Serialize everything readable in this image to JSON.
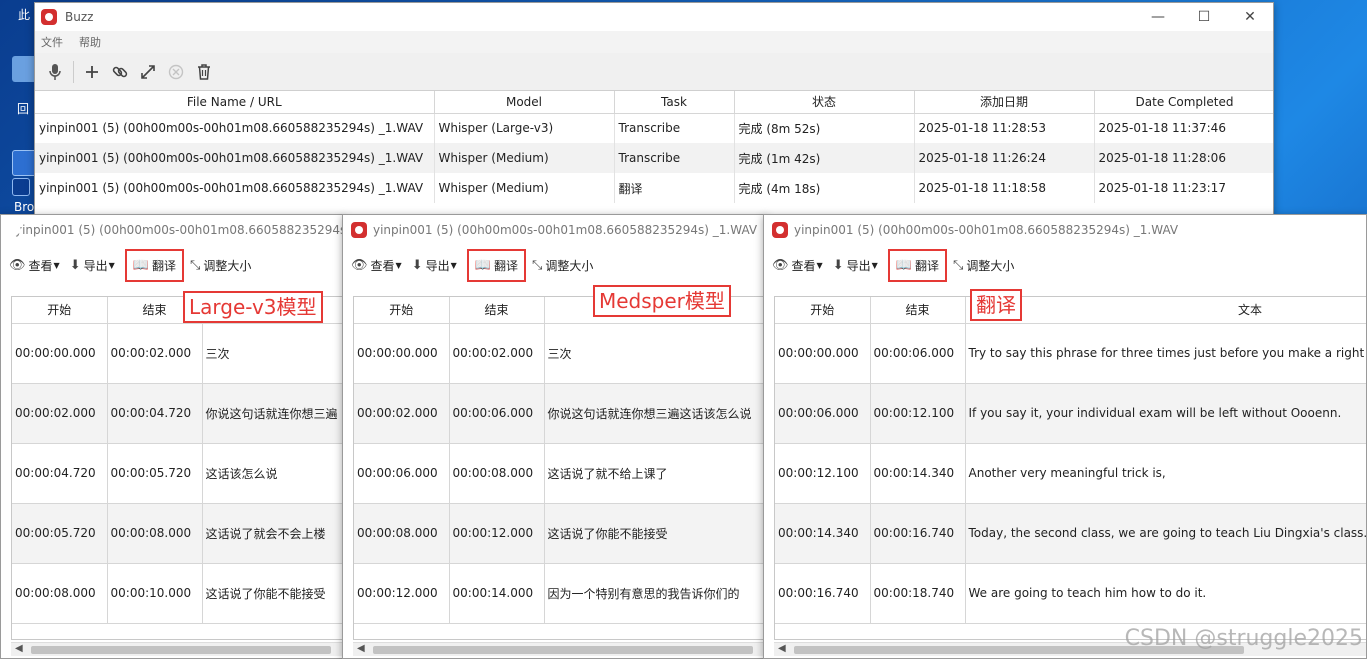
{
  "desktop": {
    "labels": [
      "此",
      "回",
      "Bro"
    ]
  },
  "main_window": {
    "title": "Buzz",
    "controls": {
      "minimize": "—",
      "maximize": "☐",
      "close": "✕"
    },
    "menu": [
      "文件",
      "帮助"
    ],
    "table": {
      "headers": [
        "File Name / URL",
        "Model",
        "Task",
        "状态",
        "添加日期",
        "Date Completed"
      ],
      "rows": [
        [
          "yinpin001 (5)  (00h00m00s-00h01m08.660588235294s)  _1.WAV",
          "Whisper (Large-v3)",
          "Transcribe",
          "完成 (8m 52s)",
          "2025-01-18 11:28:53",
          "2025-01-18 11:37:46"
        ],
        [
          "yinpin001 (5)  (00h00m00s-00h01m08.660588235294s)  _1.WAV",
          "Whisper (Medium)",
          "Transcribe",
          "完成 (1m 42s)",
          "2025-01-18 11:26:24",
          "2025-01-18 11:28:06"
        ],
        [
          "yinpin001 (5)  (00h00m00s-00h01m08.660588235294s)  _1.WAV",
          "Whisper (Medium)",
          "翻译",
          "完成 (4m 18s)",
          "2025-01-18 11:18:58",
          "2025-01-18 11:23:17"
        ]
      ]
    }
  },
  "transcript_windows": [
    {
      "title": "yinpin001 (5)  (00h00m00s-00h01m08.660588235294s)  _1.WAV",
      "toolbar": {
        "view": "查看",
        "export": "导出",
        "translate": "翻译",
        "resize": "调整大小"
      },
      "annotation": "Large-v3模型",
      "headers": [
        "开始",
        "结束",
        ""
      ],
      "rows": [
        [
          "00:00:00.000",
          "00:00:02.000",
          "三次"
        ],
        [
          "00:00:02.000",
          "00:00:04.720",
          "你说这句话就连你想三遍"
        ],
        [
          "00:00:04.720",
          "00:00:05.720",
          "这话该怎么说"
        ],
        [
          "00:00:05.720",
          "00:00:08.000",
          "这话说了就会不会上楼"
        ],
        [
          "00:00:08.000",
          "00:00:10.000",
          "这话说了你能不能接受"
        ]
      ]
    },
    {
      "title": "yinpin001 (5)  (00h00m00s-00h01m08.660588235294s)  _1.WAV",
      "toolbar": {
        "view": "查看",
        "export": "导出",
        "translate": "翻译",
        "resize": "调整大小"
      },
      "annotation": "Medsper模型",
      "headers": [
        "开始",
        "结束",
        ""
      ],
      "rows": [
        [
          "00:00:00.000",
          "00:00:02.000",
          "三次"
        ],
        [
          "00:00:02.000",
          "00:00:06.000",
          "你说这句话就连你想三遍这话该怎么说"
        ],
        [
          "00:00:06.000",
          "00:00:08.000",
          "这话说了就不给上课了"
        ],
        [
          "00:00:08.000",
          "00:00:12.000",
          "这话说了你能不能接受"
        ],
        [
          "00:00:12.000",
          "00:00:14.000",
          "因为一个特别有意思的我告诉你们的"
        ]
      ]
    },
    {
      "title": "yinpin001 (5)  (00h00m00s-00h01m08.660588235294s)  _1.WAV",
      "toolbar": {
        "view": "查看",
        "export": "导出",
        "translate": "翻译",
        "resize": "调整大小"
      },
      "annotation": "翻译",
      "headers": [
        "开始",
        "结束",
        "文本"
      ],
      "rows": [
        [
          "00:00:00.000",
          "00:00:06.000",
          "Try to say this phrase for three times just before you make a right ch"
        ],
        [
          "00:00:06.000",
          "00:00:12.100",
          "If you say it, your individual exam will be left without Oooenn."
        ],
        [
          "00:00:12.100",
          "00:00:14.340",
          "Another very meaningful trick is,"
        ],
        [
          "00:00:14.340",
          "00:00:16.740",
          "Today, the second class, we are going to teach Liu Dingxia's class."
        ],
        [
          "00:00:16.740",
          "00:00:18.740",
          "We are going to teach him how to do it."
        ]
      ]
    }
  ],
  "watermark": "CSDN @struggle2025",
  "colors": {
    "accent_red": "#e53935",
    "app_icon": "#d32f2f"
  },
  "icons": [
    "mic-icon",
    "plus-icon",
    "link-icon",
    "expand-icon",
    "cancel-icon",
    "trash-icon",
    "eye-icon",
    "download-icon",
    "translate-book-icon",
    "resize-icon"
  ]
}
